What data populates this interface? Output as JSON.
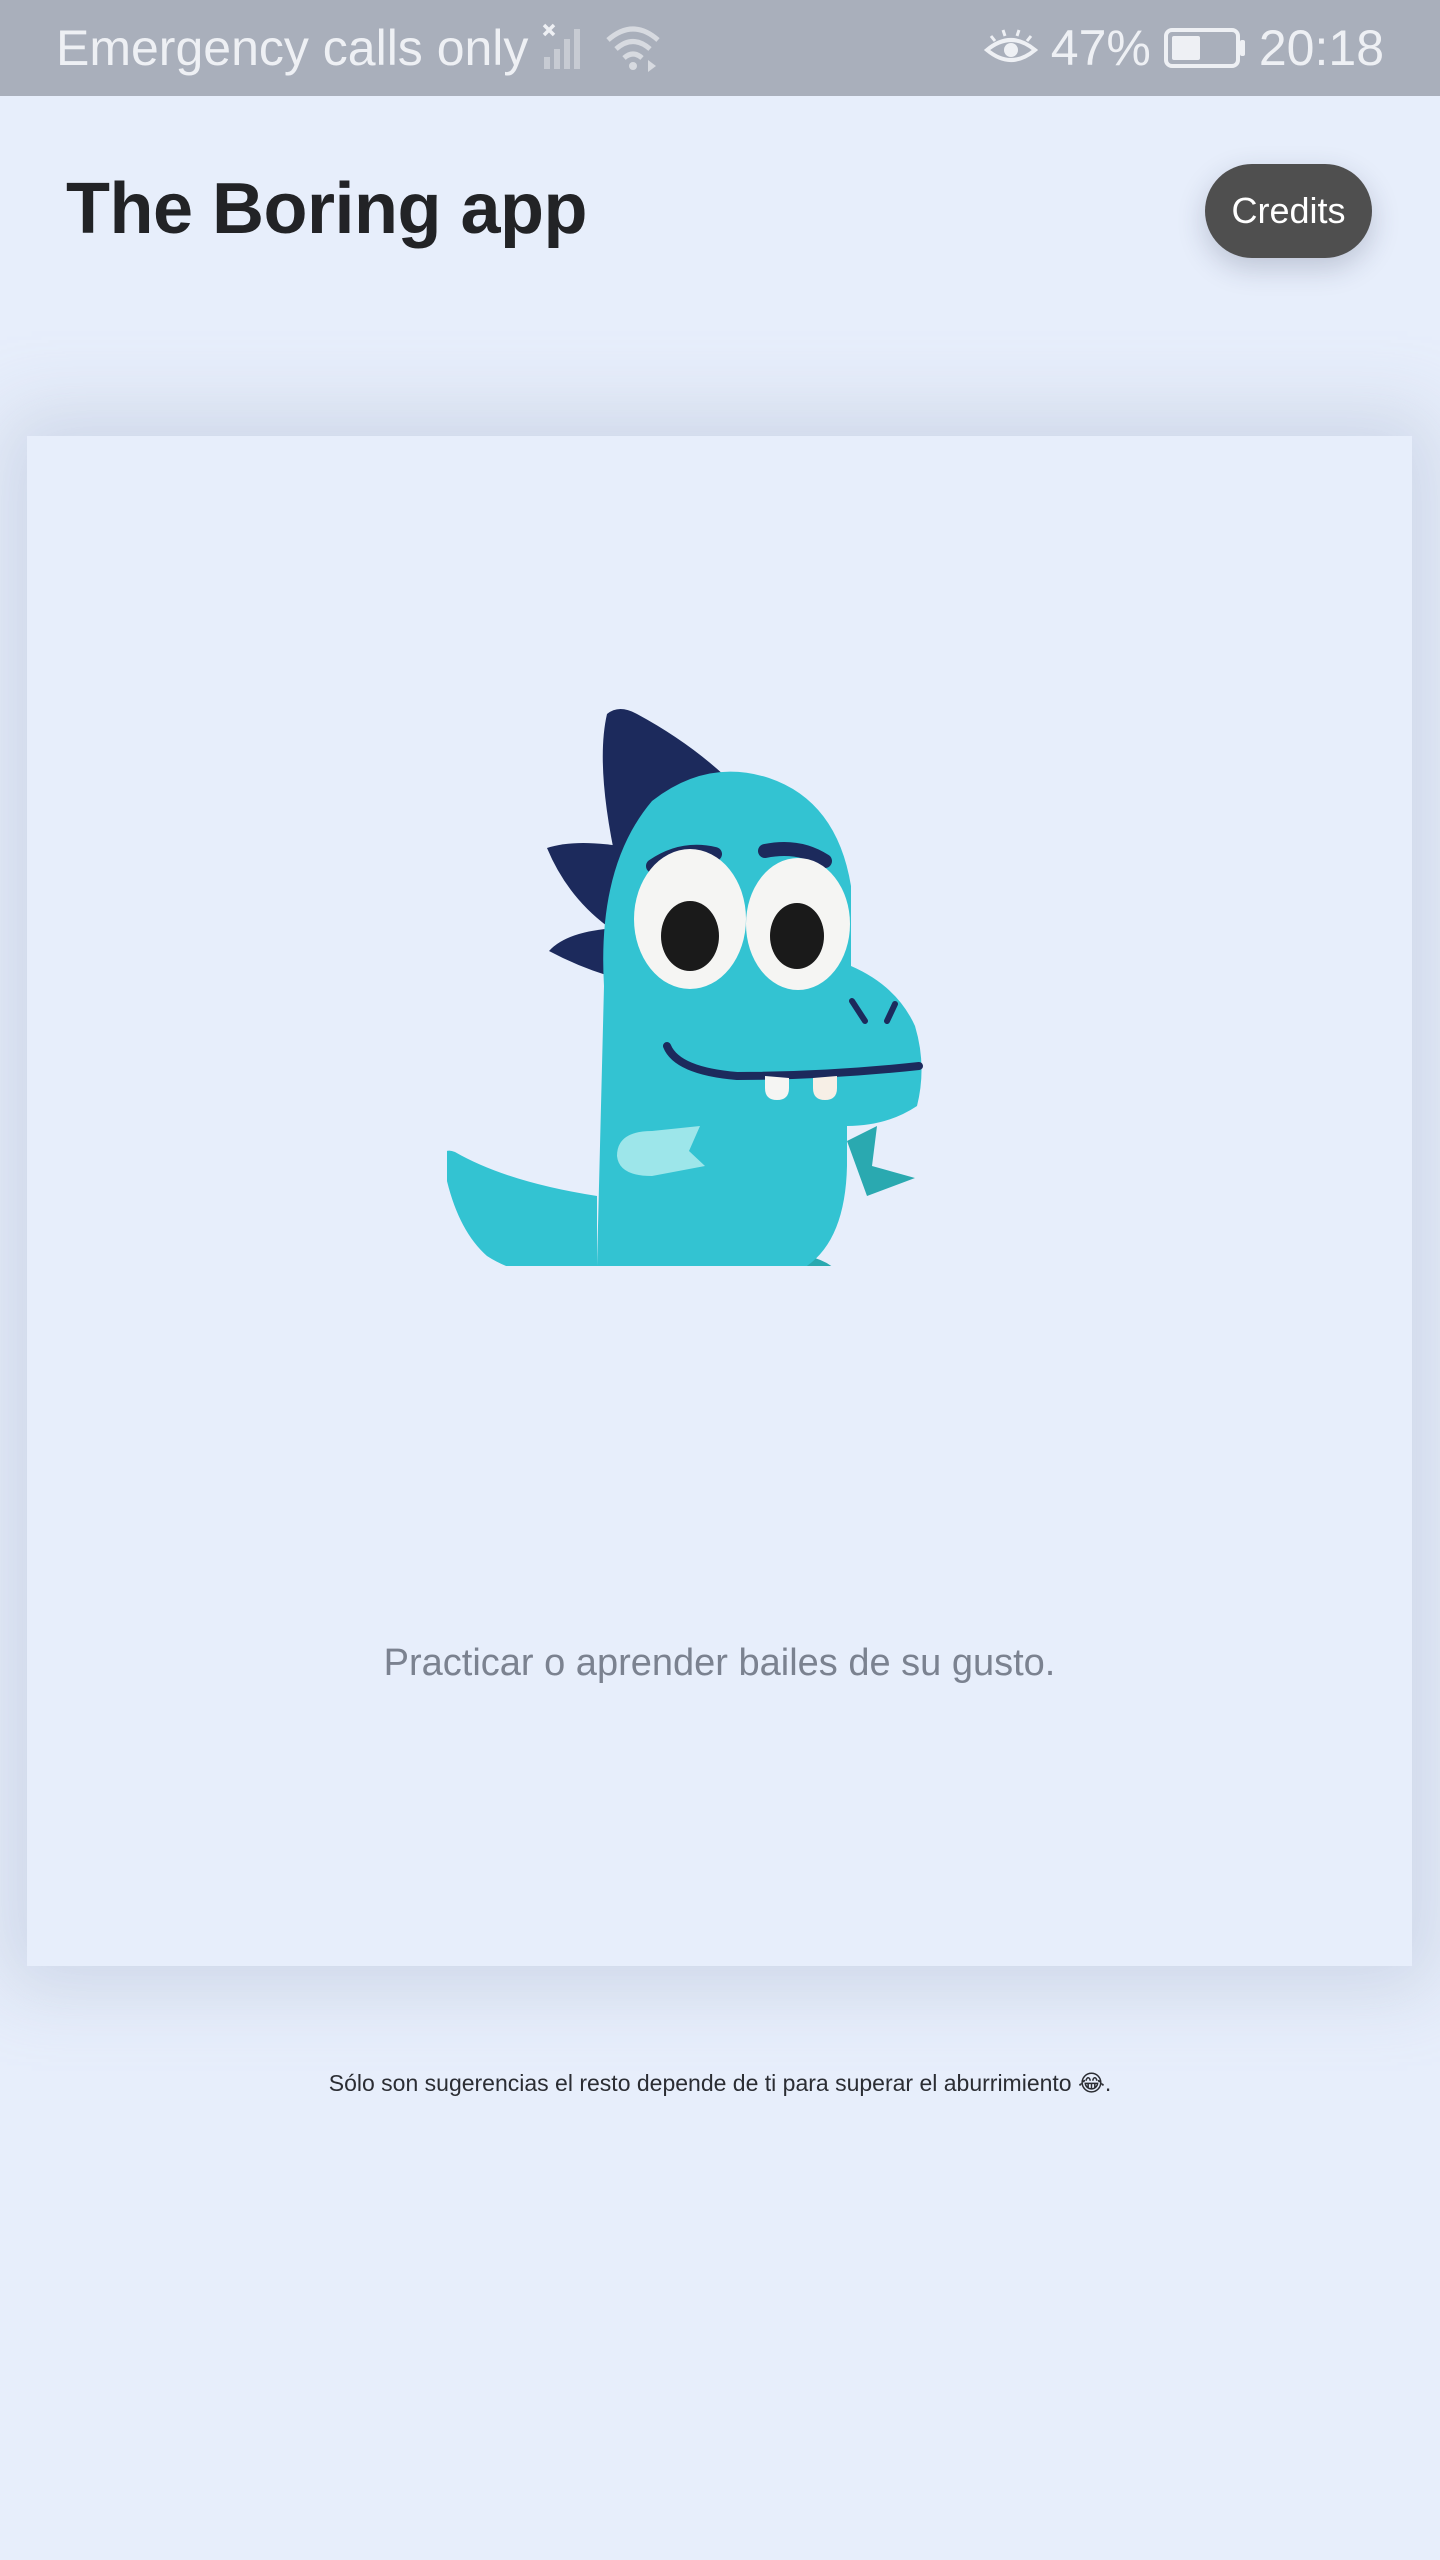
{
  "status_bar": {
    "carrier": "Emergency calls only",
    "battery_percent": "47%",
    "time": "20:18",
    "battery_level": 0.47,
    "icons": [
      "signal-off-icon",
      "wifi-icon",
      "eye-comfort-icon",
      "battery-icon"
    ]
  },
  "header": {
    "title": "The Boring app",
    "credits_label": "Credits"
  },
  "card": {
    "illustration": "dinosaur-illustration",
    "activity": "Practicar o aprender bailes de su gusto."
  },
  "footer": {
    "note": "Sólo son sugerencias el resto depende de ti para superar el aburrimiento 😂."
  },
  "colors": {
    "background": "#e7eefb",
    "status_bar": "#a9afbb",
    "credits_button": "#4f4f4f",
    "dino_body": "#33c3d2",
    "dino_spikes": "#1c2a5c"
  }
}
